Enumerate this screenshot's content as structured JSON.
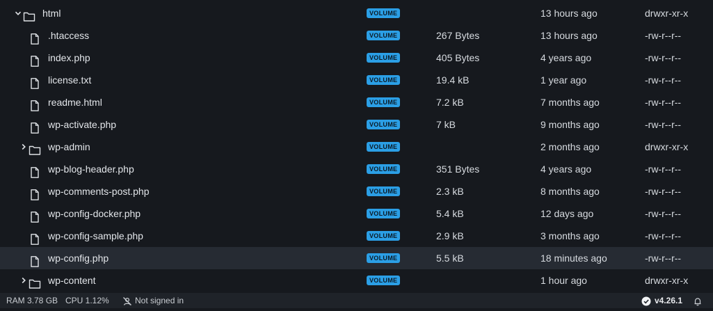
{
  "rows": [
    {
      "name": "html",
      "type": "folder",
      "expanded": true,
      "depth": 0,
      "badge": "VOLUME",
      "size": "",
      "modified": "13 hours ago",
      "perms": "drwxr-xr-x"
    },
    {
      "name": ".htaccess",
      "type": "file",
      "depth": 1,
      "badge": "VOLUME",
      "size": "267 Bytes",
      "modified": "13 hours ago",
      "perms": "-rw-r--r--"
    },
    {
      "name": "index.php",
      "type": "file",
      "depth": 1,
      "badge": "VOLUME",
      "size": "405 Bytes",
      "modified": "4 years ago",
      "perms": "-rw-r--r--"
    },
    {
      "name": "license.txt",
      "type": "file",
      "depth": 1,
      "badge": "VOLUME",
      "size": "19.4 kB",
      "modified": "1 year ago",
      "perms": "-rw-r--r--"
    },
    {
      "name": "readme.html",
      "type": "file",
      "depth": 1,
      "badge": "VOLUME",
      "size": "7.2 kB",
      "modified": "7 months ago",
      "perms": "-rw-r--r--"
    },
    {
      "name": "wp-activate.php",
      "type": "file",
      "depth": 1,
      "badge": "VOLUME",
      "size": "7 kB",
      "modified": "9 months ago",
      "perms": "-rw-r--r--"
    },
    {
      "name": "wp-admin",
      "type": "folder",
      "expanded": false,
      "depth": 1,
      "badge": "VOLUME",
      "size": "",
      "modified": "2 months ago",
      "perms": "drwxr-xr-x"
    },
    {
      "name": "wp-blog-header.php",
      "type": "file",
      "depth": 1,
      "badge": "VOLUME",
      "size": "351 Bytes",
      "modified": "4 years ago",
      "perms": "-rw-r--r--"
    },
    {
      "name": "wp-comments-post.php",
      "type": "file",
      "depth": 1,
      "badge": "VOLUME",
      "size": "2.3 kB",
      "modified": "8 months ago",
      "perms": "-rw-r--r--"
    },
    {
      "name": "wp-config-docker.php",
      "type": "file",
      "depth": 1,
      "badge": "VOLUME",
      "size": "5.4 kB",
      "modified": "12 days ago",
      "perms": "-rw-r--r--"
    },
    {
      "name": "wp-config-sample.php",
      "type": "file",
      "depth": 1,
      "badge": "VOLUME",
      "size": "2.9 kB",
      "modified": "3 months ago",
      "perms": "-rw-r--r--"
    },
    {
      "name": "wp-config.php",
      "type": "file",
      "depth": 1,
      "badge": "VOLUME",
      "size": "5.5 kB",
      "modified": "18 minutes ago",
      "perms": "-rw-r--r--",
      "selected": true
    },
    {
      "name": "wp-content",
      "type": "folder",
      "expanded": false,
      "depth": 1,
      "badge": "VOLUME",
      "size": "",
      "modified": "1 hour ago",
      "perms": "drwxr-xr-x"
    }
  ],
  "statusbar": {
    "ram": "RAM 3.78 GB",
    "cpu": "CPU 1.12%",
    "signin": "Not signed in",
    "version": "v4.26.1"
  },
  "colors": {
    "background": "#16191e",
    "badge": "#2b9fe6",
    "selected_row": "#262b33",
    "statusbar": "#1f2329"
  }
}
